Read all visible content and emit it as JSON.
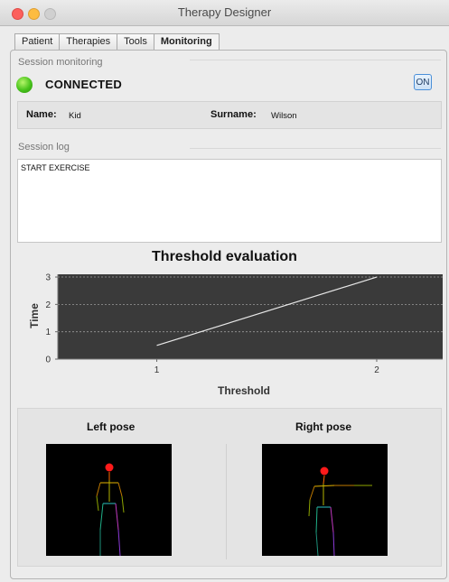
{
  "window": {
    "title": "Therapy Designer"
  },
  "tabs": [
    {
      "label": "Patient",
      "active": false
    },
    {
      "label": "Therapies",
      "active": false
    },
    {
      "label": "Tools",
      "active": false
    },
    {
      "label": "Monitoring",
      "active": true
    }
  ],
  "session_monitoring": {
    "label": "Session monitoring",
    "status_text": "CONNECTED",
    "status_color": "#46c21a",
    "toggle_label": "ON"
  },
  "patient": {
    "name_label": "Name:",
    "name_value": "Kid",
    "surname_label": "Surname:",
    "surname_value": "Wilson"
  },
  "session_log": {
    "label": "Session log",
    "text": "START EXERCISE"
  },
  "chart_data": {
    "type": "line",
    "title": "Threshold evaluation",
    "xlabel": "Threshold",
    "ylabel": "Time",
    "x": [
      1,
      2
    ],
    "series": [
      {
        "values": [
          0.5,
          3
        ]
      }
    ],
    "xlim": [
      0.55,
      2.3
    ],
    "ylim": [
      0,
      3.1
    ],
    "xticks": [
      1,
      2
    ],
    "yticks": [
      0,
      1,
      2,
      3
    ],
    "grid": true,
    "plot_background": "#3a3a3a",
    "line_color": "#e8e8e8"
  },
  "poses": {
    "left_label": "Left pose",
    "right_label": "Right pose"
  }
}
